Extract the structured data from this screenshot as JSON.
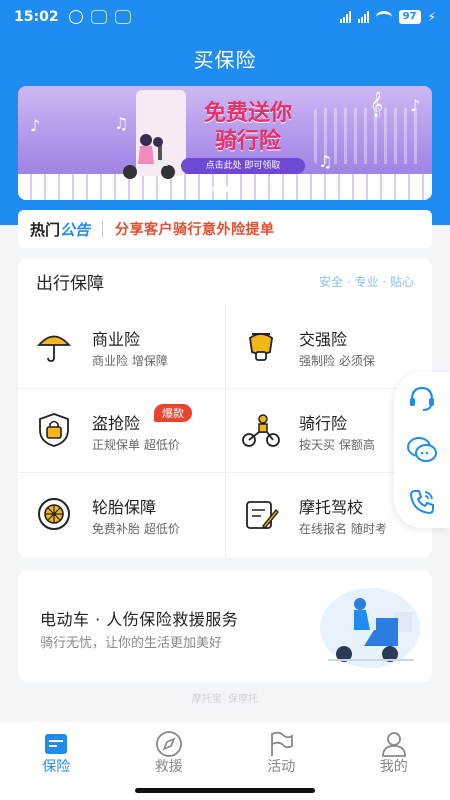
{
  "status_bar": {
    "time": "15:02",
    "battery": "97",
    "network_1": "HD",
    "network_2": "HD"
  },
  "header": {
    "title": "买保险"
  },
  "banner": {
    "headline_line1": "免费送你",
    "headline_line2": "骑行险",
    "subtitle": "点击此处 即可领取",
    "page_count": 3,
    "active_page": 2
  },
  "notice": {
    "tag_part1": "热门",
    "tag_part2": "公告",
    "text": "分享客户骑行意外险提单"
  },
  "travel": {
    "title": "出行保障",
    "slogan": "安全 · 专业 · 贴心",
    "items": [
      {
        "name": "商业险",
        "desc": "商业险  增保障",
        "icon": "umbrella-icon"
      },
      {
        "name": "交强险",
        "desc": "强制险  必须保",
        "icon": "scooter-icon"
      },
      {
        "name": "盗抢险",
        "desc": "正规保单  超低价",
        "icon": "lock-shield-icon",
        "badge": "爆款"
      },
      {
        "name": "骑行险",
        "desc": "按天买  保额高",
        "icon": "rider-icon"
      },
      {
        "name": "轮胎保障",
        "desc": "免费补胎  超低价",
        "icon": "tire-icon"
      },
      {
        "name": "摩托驾校",
        "desc": "在线报名  随时考",
        "icon": "license-icon"
      }
    ]
  },
  "float_bar": {
    "icons": [
      "customer-service-icon",
      "chat-icon",
      "phone-icon"
    ]
  },
  "rescue": {
    "title": "电动车 · 人伤保险救援服务",
    "subtitle": "骑行无忧，让你的生活更加美好"
  },
  "watermark": {
    "brand1": "摩托宝",
    "brand2": "保摩托"
  },
  "tabbar": {
    "tabs": [
      {
        "label": "保险",
        "icon": "insurance-icon",
        "active": true
      },
      {
        "label": "救援",
        "icon": "compass-icon",
        "active": false
      },
      {
        "label": "活动",
        "icon": "flag-icon",
        "active": false
      },
      {
        "label": "我的",
        "icon": "user-icon",
        "active": false
      }
    ]
  },
  "colors": {
    "primary": "#1f8cf2",
    "notice_text": "#e64c2d",
    "badge": "#e8442f",
    "banner_headline": "#e6306c"
  }
}
